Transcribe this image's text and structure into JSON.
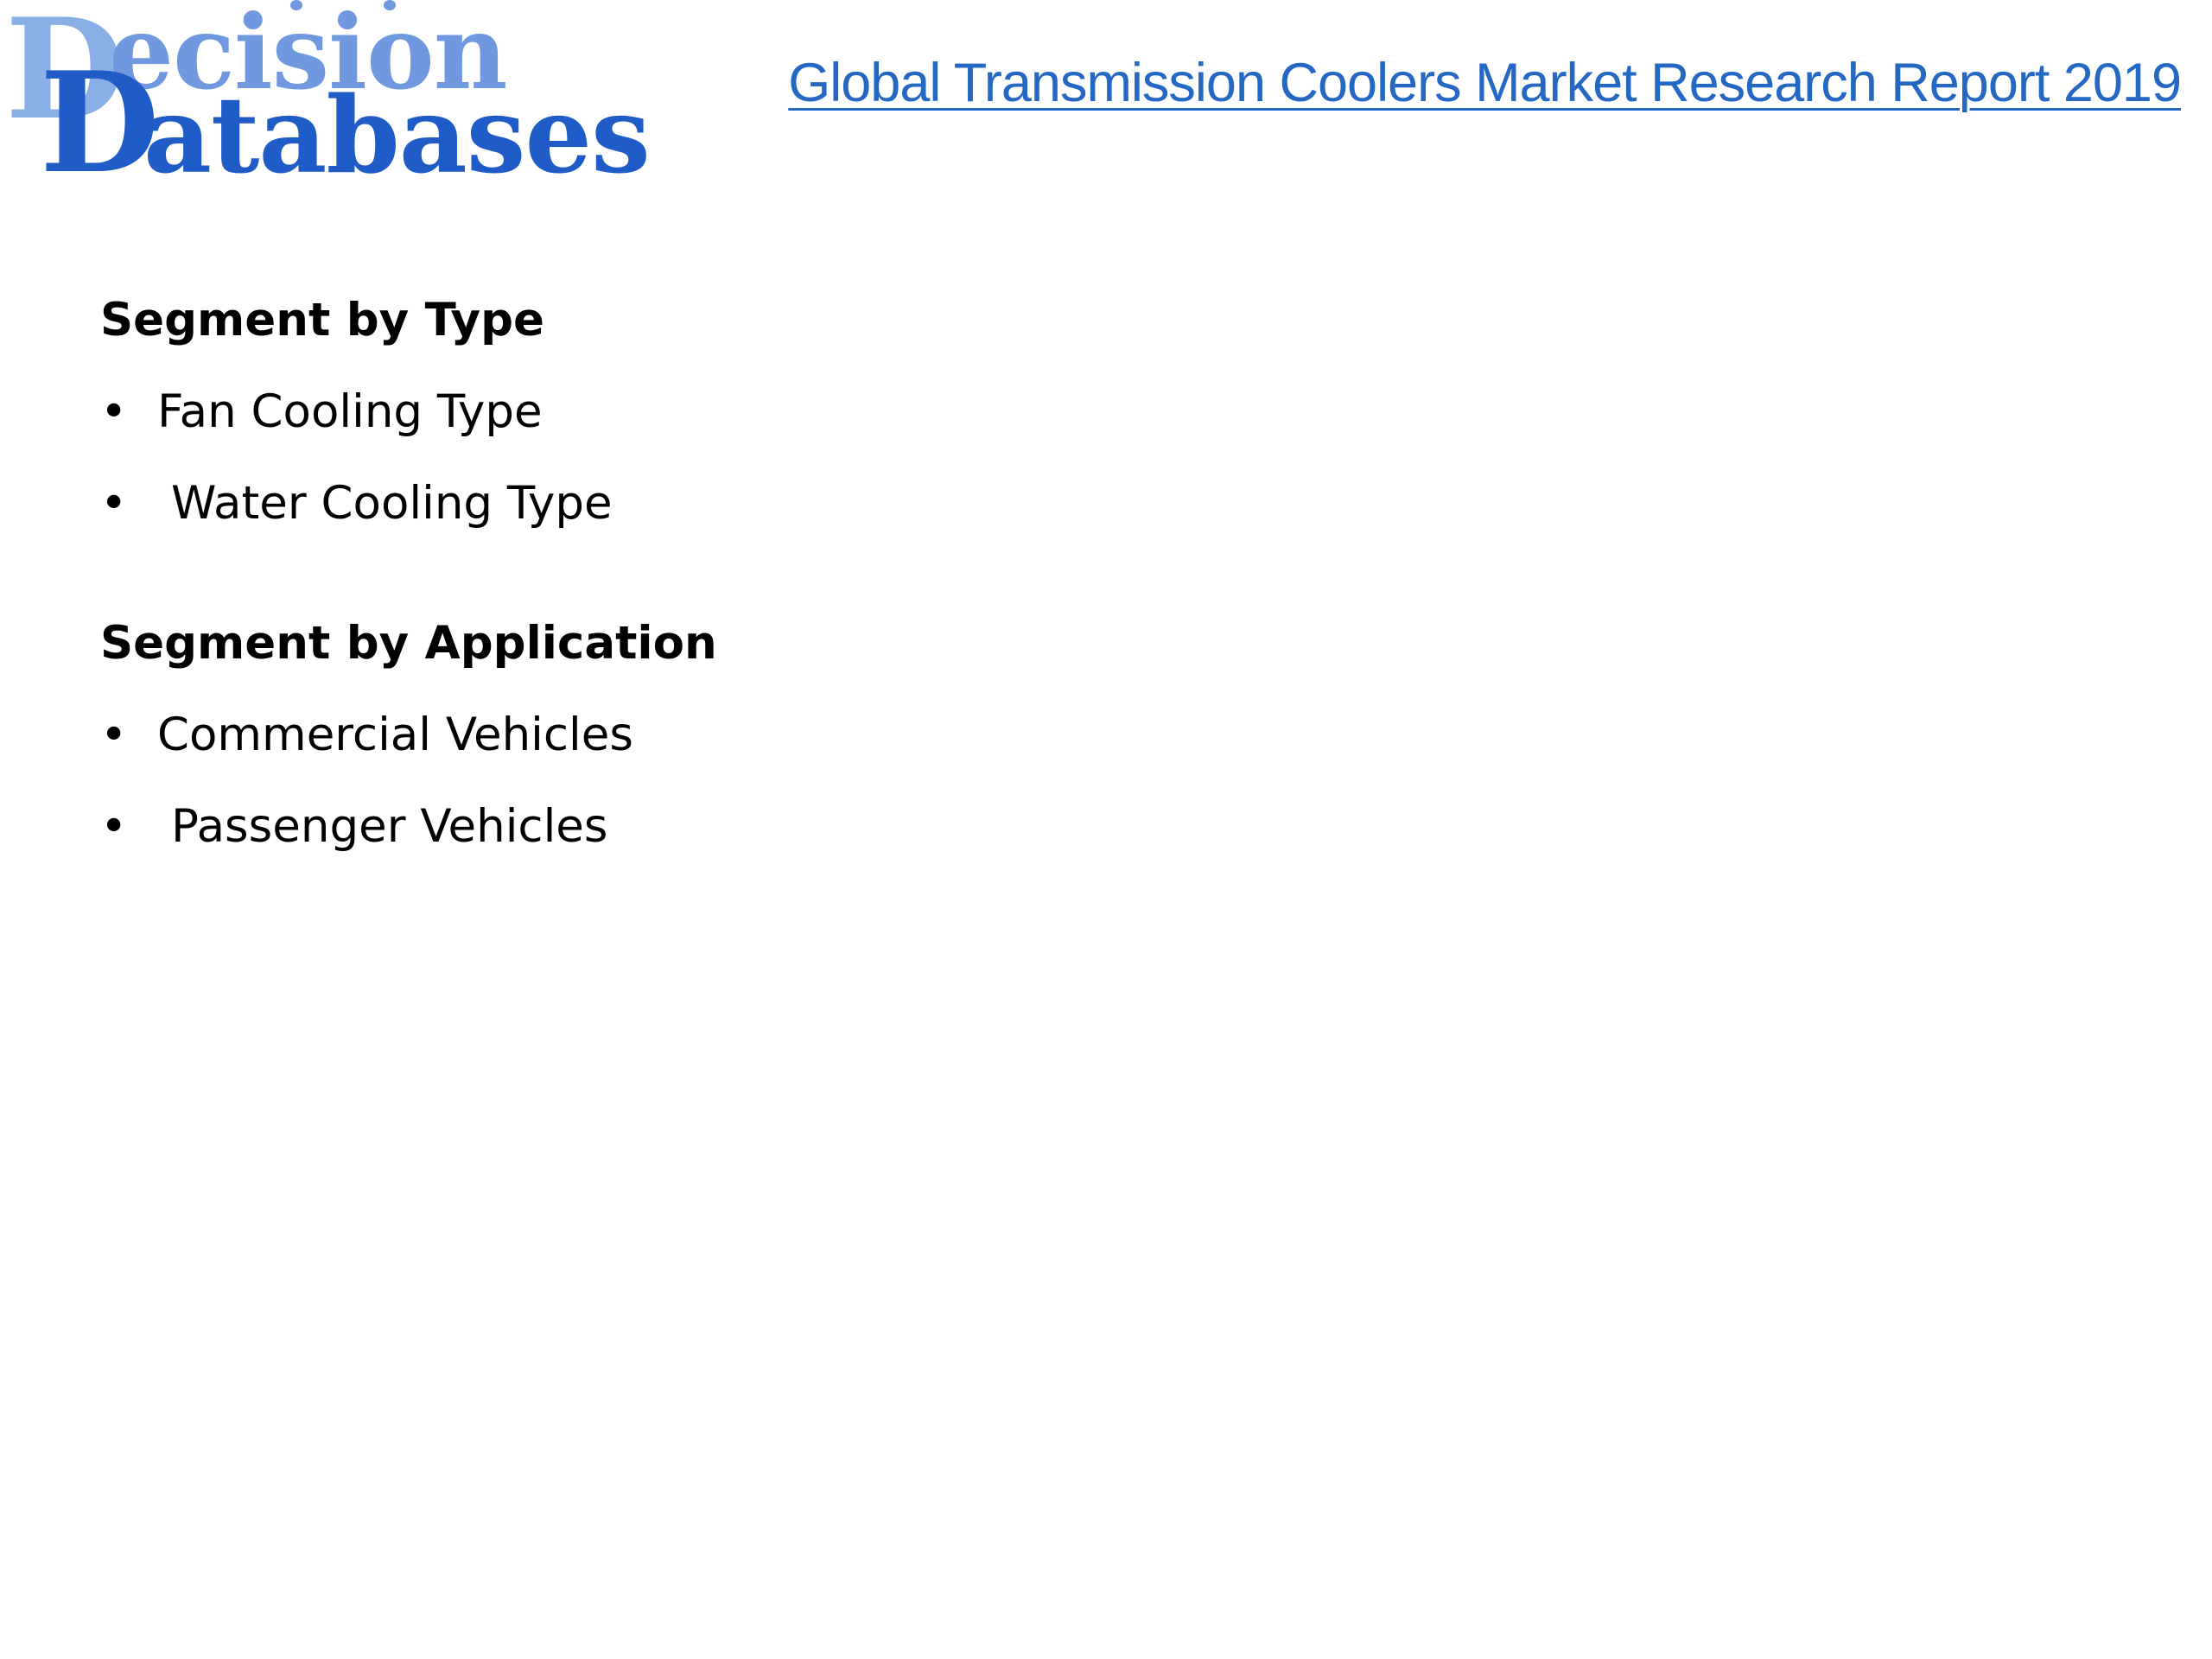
{
  "logo": {
    "line1_initial": "D",
    "line1_rest": "ecision",
    "line2_initial": "D",
    "line2_rest": "atabases",
    "colors": {
      "light": "#8aaee6",
      "mid": "#6f98df",
      "dark": "#1f5cc7"
    }
  },
  "title": {
    "text": "Global Transmission Coolers Market Research Report 2019",
    "color": "#2468c4"
  },
  "sections": [
    {
      "heading": "Segment by Type",
      "items": [
        "Fan Cooling Type",
        "Water Cooling Type"
      ]
    },
    {
      "heading": "Segment by Application",
      "items": [
        "Commercial Vehicles",
        "Passenger Vehicles"
      ]
    }
  ],
  "bullet_symbol": "•"
}
